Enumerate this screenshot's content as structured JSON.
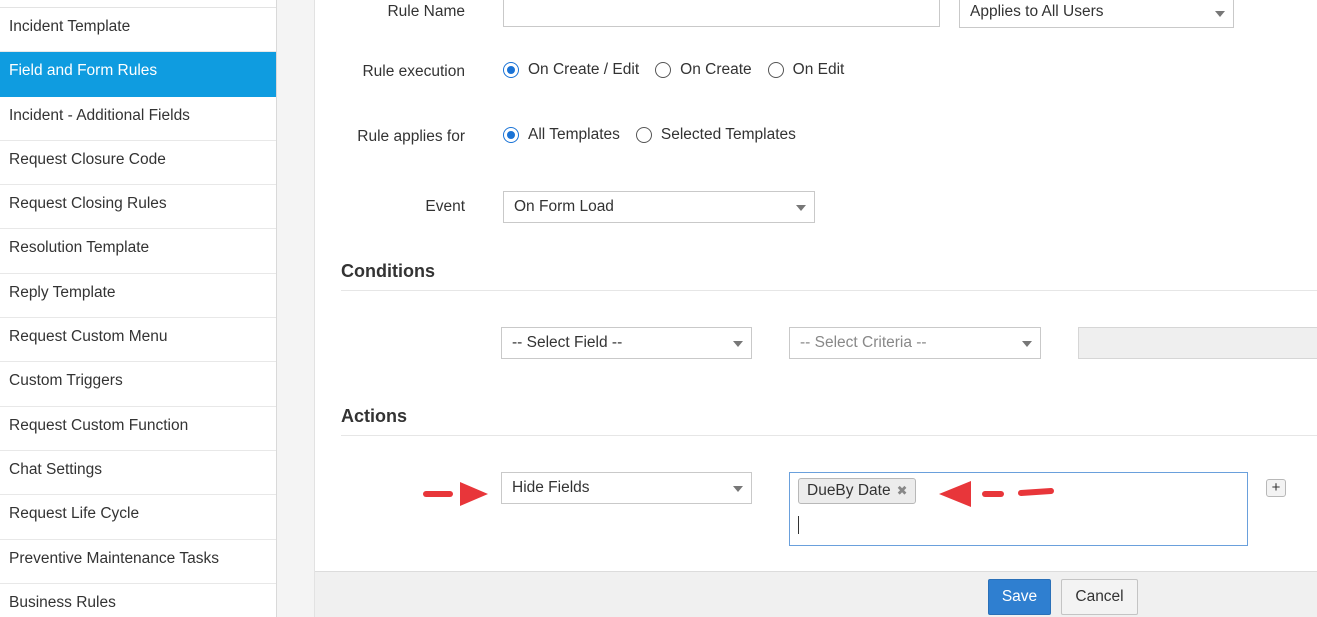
{
  "sidebar": {
    "items": [
      {
        "label": "Incident Template",
        "active": false
      },
      {
        "label": "Field and Form Rules",
        "active": true
      },
      {
        "label": "Incident - Additional Fields",
        "active": false
      },
      {
        "label": "Request Closure Code",
        "active": false
      },
      {
        "label": "Request Closing Rules",
        "active": false
      },
      {
        "label": "Resolution Template",
        "active": false
      },
      {
        "label": "Reply Template",
        "active": false
      },
      {
        "label": "Request Custom Menu",
        "active": false
      },
      {
        "label": "Custom Triggers",
        "active": false
      },
      {
        "label": "Request Custom Function",
        "active": false
      },
      {
        "label": "Chat Settings",
        "active": false
      },
      {
        "label": "Request Life Cycle",
        "active": false
      },
      {
        "label": "Preventive Maintenance Tasks",
        "active": false
      },
      {
        "label": "Business Rules",
        "active": false
      }
    ]
  },
  "form": {
    "rule_name_label": "Rule Name",
    "rule_name_value": "",
    "applies_to_value": "Applies to All Users",
    "rule_execution_label": "Rule execution",
    "rule_execution_options": [
      "On Create / Edit",
      "On Create",
      "On Edit"
    ],
    "rule_execution_selected": 0,
    "rule_applies_label": "Rule applies for",
    "rule_applies_options": [
      "All Templates",
      "Selected Templates"
    ],
    "rule_applies_selected": 0,
    "event_label": "Event",
    "event_value": "On Form Load"
  },
  "conditions": {
    "title": "Conditions",
    "field_placeholder": "-- Select Field --",
    "criteria_placeholder": "-- Select Criteria --"
  },
  "actions": {
    "title": "Actions",
    "action_value": "Hide Fields",
    "tags": [
      "DueBy Date"
    ],
    "add_label": "+"
  },
  "footer": {
    "save_label": "Save",
    "cancel_label": "Cancel"
  },
  "colors": {
    "sidebar_active": "#0f9ce0",
    "save_button": "#2f7fd0",
    "annotation_arrow": "#e8363a",
    "radio_checked": "#1a73d6"
  }
}
